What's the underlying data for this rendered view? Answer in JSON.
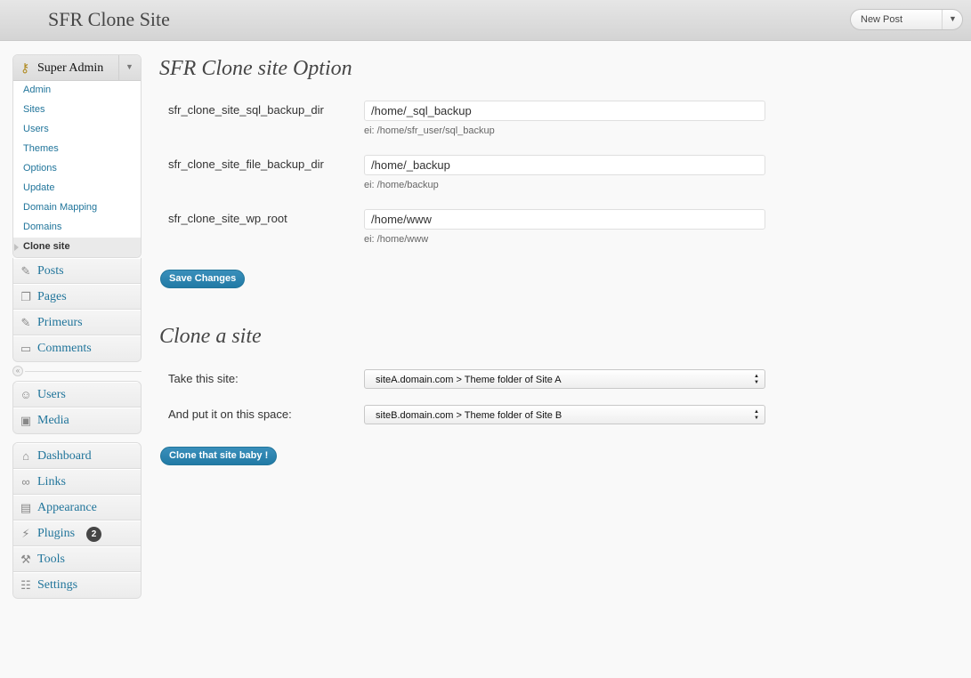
{
  "header": {
    "site_title": "SFR Clone Site",
    "new_post": "New Post"
  },
  "superadmin": {
    "title": "Super Admin",
    "items": [
      "Admin",
      "Sites",
      "Users",
      "Themes",
      "Options",
      "Update",
      "Domain Mapping",
      "Domains",
      "Clone site"
    ],
    "current": "Clone site"
  },
  "menu_a": [
    {
      "label": "Posts",
      "icon": "pushpin-icon"
    },
    {
      "label": "Pages",
      "icon": "pages-icon"
    },
    {
      "label": "Primeurs",
      "icon": "pushpin-icon"
    },
    {
      "label": "Comments",
      "icon": "comment-icon"
    }
  ],
  "menu_b": [
    {
      "label": "Users",
      "icon": "users-icon"
    },
    {
      "label": "Media",
      "icon": "media-icon"
    }
  ],
  "menu_c": [
    {
      "label": "Dashboard",
      "icon": "home-icon"
    },
    {
      "label": "Links",
      "icon": "link-icon"
    },
    {
      "label": "Appearance",
      "icon": "appearance-icon"
    },
    {
      "label": "Plugins",
      "icon": "plug-icon",
      "badge": "2"
    },
    {
      "label": "Tools",
      "icon": "tools-icon"
    },
    {
      "label": "Settings",
      "icon": "settings-icon"
    }
  ],
  "options": {
    "title": "SFR Clone site Option",
    "fields": [
      {
        "label": "sfr_clone_site_sql_backup_dir",
        "value": "/home/_sql_backup",
        "hint": "ei: /home/sfr_user/sql_backup"
      },
      {
        "label": "sfr_clone_site_file_backup_dir",
        "value": "/home/_backup",
        "hint": "ei: /home/backup"
      },
      {
        "label": "sfr_clone_site_wp_root",
        "value": "/home/www",
        "hint": "ei: /home/www"
      }
    ],
    "save_label": "Save Changes"
  },
  "clone": {
    "title": "Clone a site",
    "take_label": "Take this site:",
    "take_value": "siteA.domain.com  >  Theme folder of Site A",
    "put_label": "And put it on this space:",
    "put_value": "siteB.domain.com  >  Theme folder of Site B",
    "button": "Clone that site baby !"
  }
}
